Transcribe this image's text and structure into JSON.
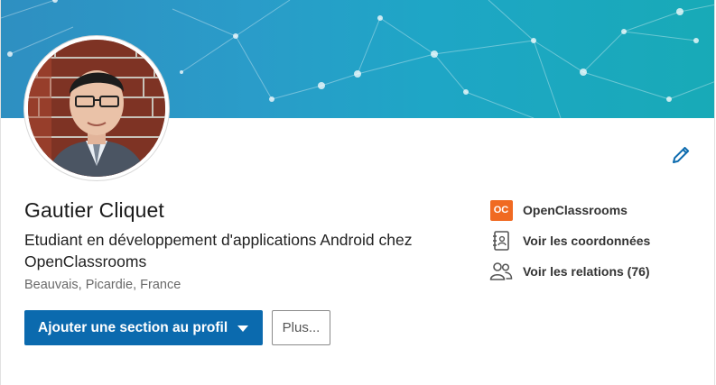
{
  "profile": {
    "name": "Gautier Cliquet",
    "headline": "Etudiant en développement d'applications Android chez OpenClassrooms",
    "location": "Beauvais, Picardie, France"
  },
  "actions": {
    "add_section_label": "Ajouter une section au profil",
    "more_label": "Plus..."
  },
  "side_links": {
    "company_logo_text": "OC",
    "company": "OpenClassrooms",
    "contact": "Voir les coordonnées",
    "connections": "Voir les relations (76)"
  },
  "colors": {
    "primary_button": "#0b6aae",
    "company_logo": "#f06a22",
    "edit_icon": "#0b6aae"
  },
  "icons": {
    "edit": "pencil-icon",
    "contact": "address-book-icon",
    "connections": "people-icon",
    "dropdown": "caret-down-icon"
  }
}
